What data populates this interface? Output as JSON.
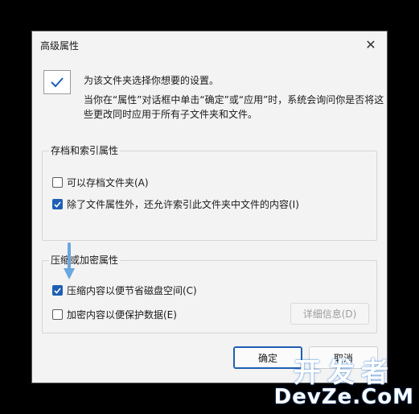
{
  "dialog": {
    "title": "高级属性",
    "intro": {
      "line1": "为该文件夹选择你想要的设置。",
      "line2": "当你在“属性”对话框中单击“确定”或“应用”时，系统会询问你是否将这",
      "line3": "些更改同时应用于所有子文件夹和文件。"
    },
    "archive_group": {
      "title": "存档和索引属性",
      "options": [
        {
          "label": "可以存档文件夹(A)",
          "checked": false
        },
        {
          "label": "除了文件属性外，还允许索引此文件夹中文件的内容(I)",
          "checked": true
        }
      ]
    },
    "compress_group": {
      "title": "压缩或加密属性",
      "options": [
        {
          "label": "压缩内容以便节省磁盘空间(C)",
          "checked": true
        },
        {
          "label": "加密内容以便保护数据(E)",
          "checked": false
        }
      ],
      "details_label": "详细信息(D)"
    },
    "ok_label": "确定",
    "cancel_label": "取消"
  },
  "watermark": {
    "cn": "开发者",
    "en": "DevZe.CoM"
  },
  "colors": {
    "accent": "#1e5fb4",
    "arrow": "#6aa6e0"
  }
}
